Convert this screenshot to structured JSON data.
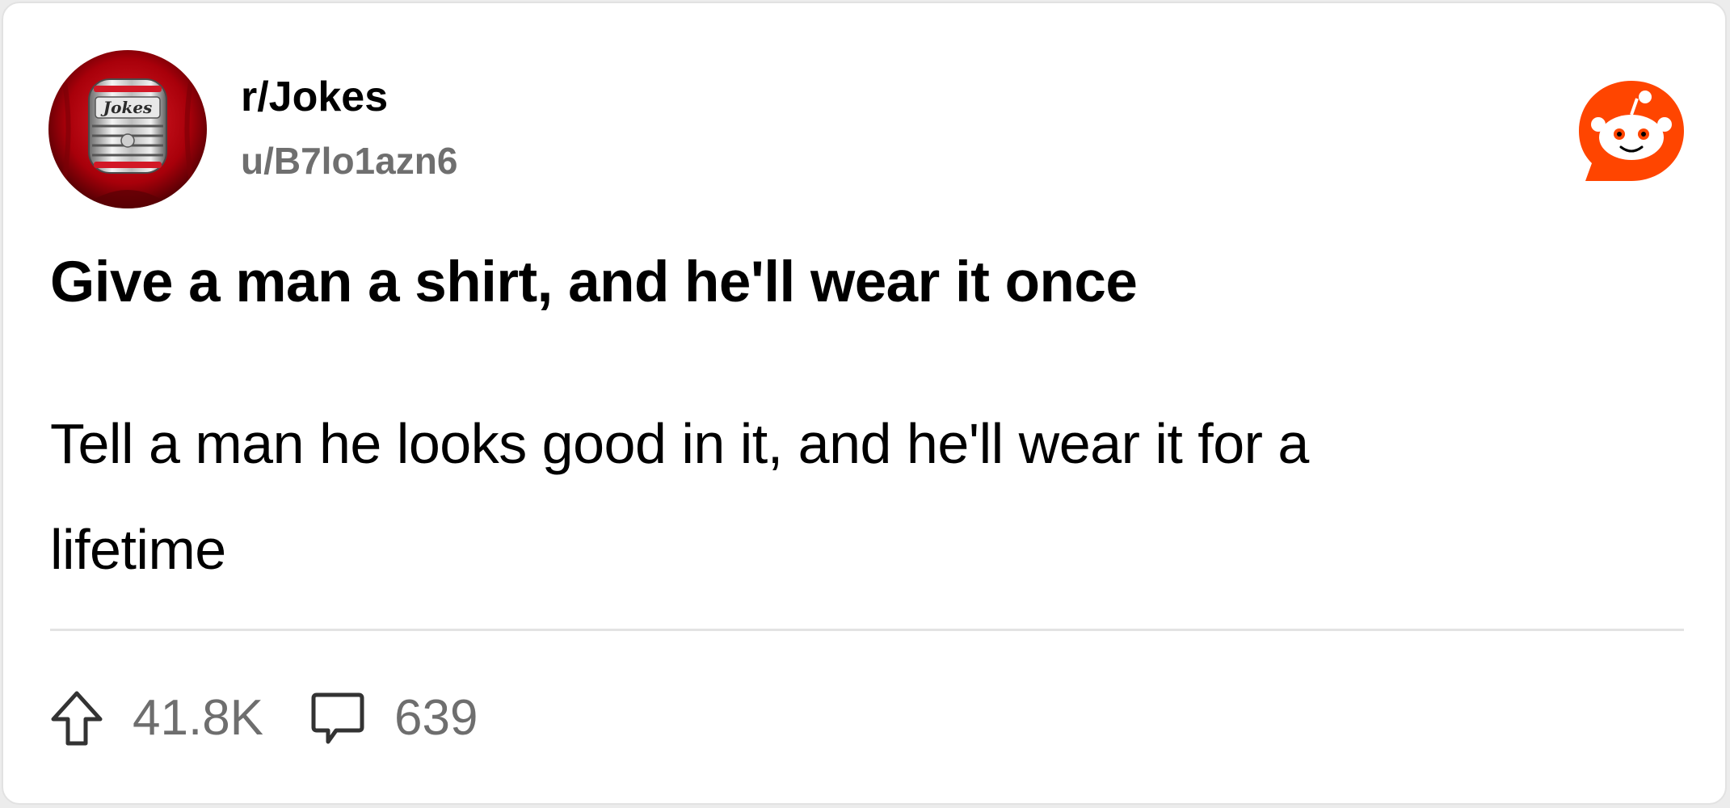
{
  "post": {
    "subreddit": "r/Jokes",
    "author": "u/B7lo1azn6",
    "avatar_text": "Jokes",
    "title": "Give a man a shirt, and he'll wear it once",
    "body_line1": "Tell a man he looks good in it, and he'll wear it for a",
    "body_line2": "lifetime",
    "upvotes": "41.8K",
    "comments": "639"
  },
  "icons": {
    "logo": "reddit-snoo-icon",
    "upvote": "upvote-arrow-icon",
    "comment": "comment-bubble-icon"
  },
  "colors": {
    "brand": "#ff4500",
    "muted_text": "#6f6f6f",
    "avatar_bg": "#b0000a"
  }
}
